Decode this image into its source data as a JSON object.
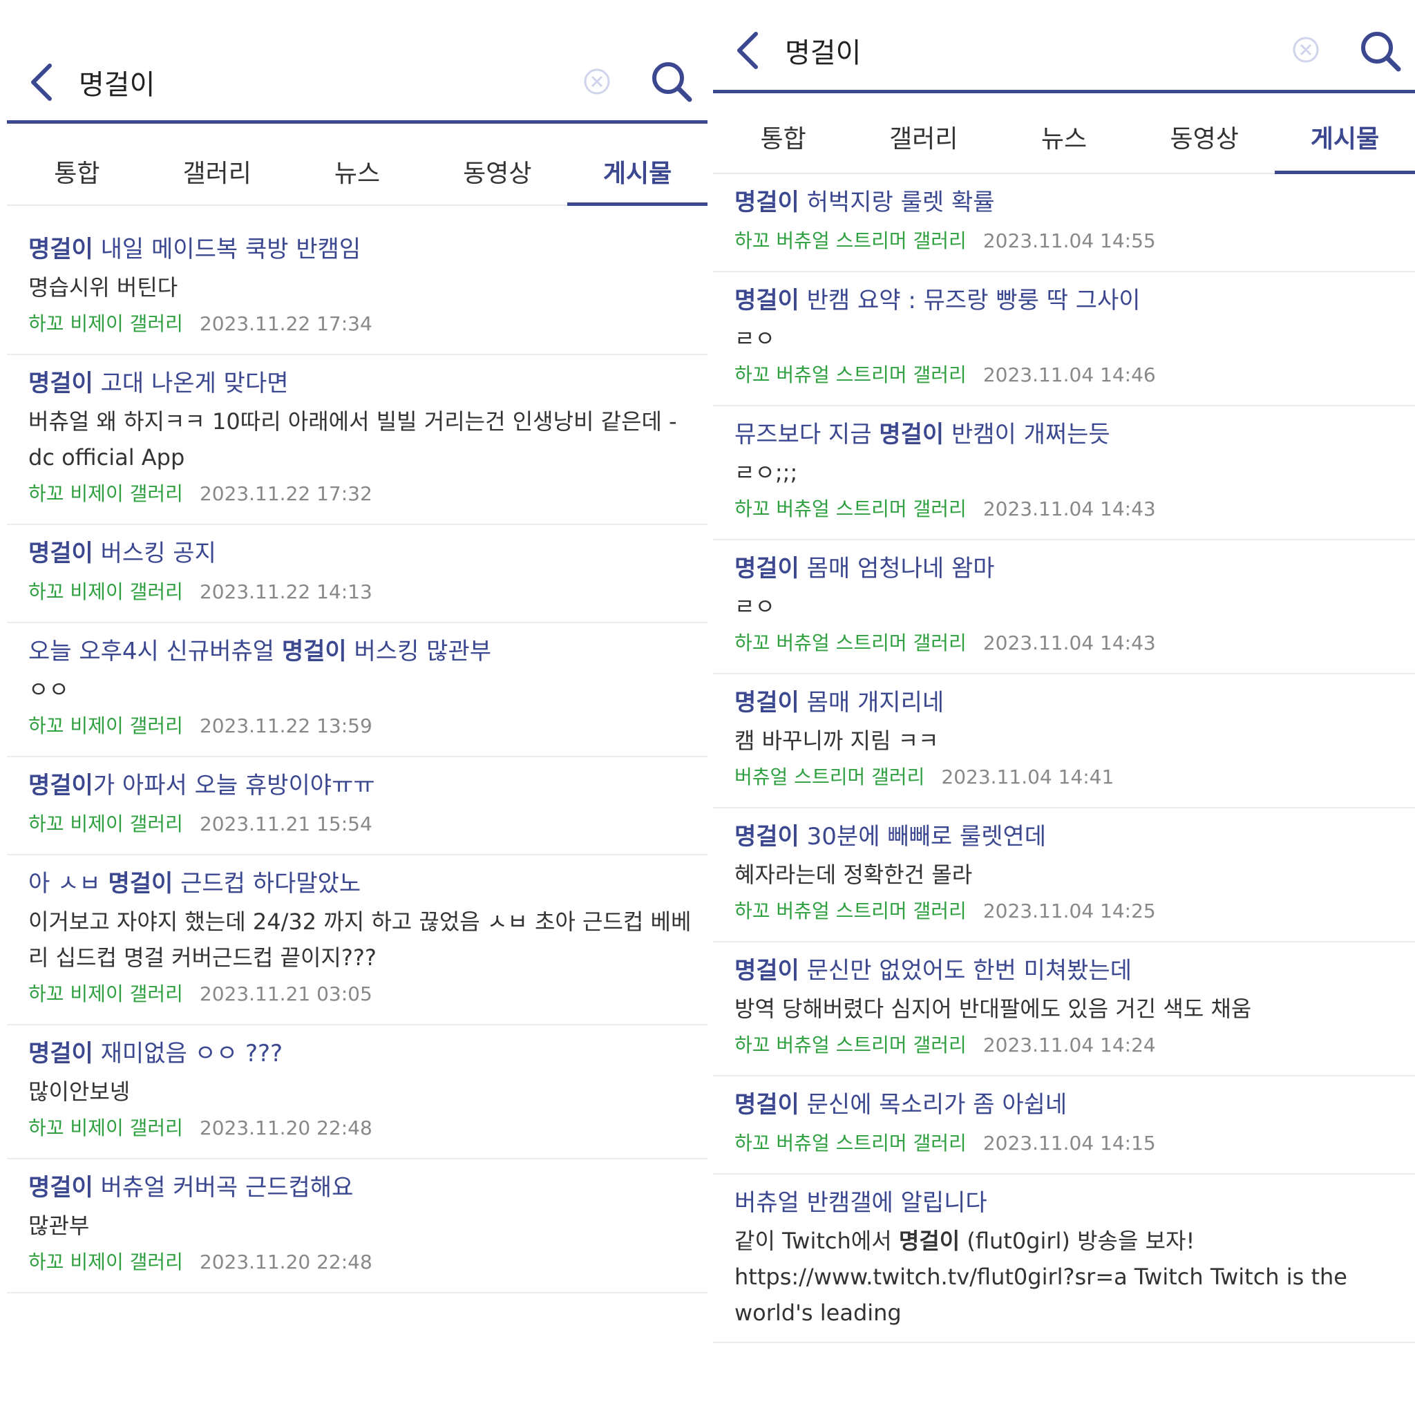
{
  "left": {
    "query": "명걸이",
    "tabs": [
      "통합",
      "갤러리",
      "뉴스",
      "동영상",
      "게시물"
    ],
    "active_tab": 4,
    "results": [
      {
        "title_pre": "",
        "title_kw": "명걸이",
        "title_post": " 내일 메이드복 쿡방 반캠임",
        "snippet": "명습시위 버틴다",
        "gallery": "하꼬 비제이 갤러리",
        "date": "2023.11.22 17:34"
      },
      {
        "title_pre": "",
        "title_kw": "명걸이",
        "title_post": " 고대 나온게 맞다면",
        "snippet": "버츄얼 왜 하지ㅋㅋ 10따리 아래에서 빌빌 거리는건 인생낭비 같은데 - dc official App",
        "gallery": "하꼬 비제이 갤러리",
        "date": "2023.11.22 17:32"
      },
      {
        "title_pre": "",
        "title_kw": "명걸이",
        "title_post": " 버스킹 공지",
        "snippet": "",
        "gallery": "하꼬 비제이 갤러리",
        "date": "2023.11.22 14:13"
      },
      {
        "title_pre": "오늘 오후4시 신규버츄얼 ",
        "title_kw": "명걸이",
        "title_post": " 버스킹 많관부",
        "snippet": "ㅇㅇ",
        "gallery": "하꼬 비제이 갤러리",
        "date": "2023.11.22 13:59"
      },
      {
        "title_pre": "",
        "title_kw": "명걸이",
        "title_post": "가 아파서 오늘 휴방이야ㅠㅠ",
        "snippet": "",
        "gallery": "하꼬 비제이 갤러리",
        "date": "2023.11.21 15:54"
      },
      {
        "title_pre": "아 ㅅㅂ ",
        "title_kw": "명걸이",
        "title_post": " 근드컵 하다말았노",
        "snippet": "이거보고 자야지 했는데 24/32 까지 하고 끊었음 ㅅㅂ 초아 근드컵 베베리 십드컵 명걸 커버근드컵 끝이지???",
        "gallery": "하꼬 비제이 갤러리",
        "date": "2023.11.21 03:05"
      },
      {
        "title_pre": "",
        "title_kw": "명걸이",
        "title_post": " 재미없음 ㅇㅇ ???",
        "snippet": "많이안보넹",
        "gallery": "하꼬 비제이 갤러리",
        "date": "2023.11.20 22:48"
      },
      {
        "title_pre": "",
        "title_kw": "명걸이",
        "title_post": " 버츄얼 커버곡 근드컵해요",
        "snippet": "많관부",
        "gallery": "하꼬 비제이 갤러리",
        "date": "2023.11.20 22:48"
      }
    ]
  },
  "right": {
    "query": "명걸이",
    "tabs": [
      "통합",
      "갤러리",
      "뉴스",
      "동영상",
      "게시물"
    ],
    "active_tab": 4,
    "results": [
      {
        "title_pre": "",
        "title_kw": "명걸이",
        "title_post": " 허벅지랑 룰렛 확률",
        "snippet": "",
        "gallery": "하꼬 버츄얼 스트리머 갤러리",
        "date": "2023.11.04 14:55"
      },
      {
        "title_pre": "",
        "title_kw": "명걸이",
        "title_post": " 반캠 요약 : 뮤즈랑 빵룽 딱 그사이",
        "snippet": "ㄹㅇ",
        "gallery": "하꼬 버츄얼 스트리머 갤러리",
        "date": "2023.11.04 14:46"
      },
      {
        "title_pre": "뮤즈보다 지금 ",
        "title_kw": "명걸이",
        "title_post": " 반캠이 개쩌는듯",
        "snippet": "ㄹㅇ;;;",
        "gallery": "하꼬 버츄얼 스트리머 갤러리",
        "date": "2023.11.04 14:43"
      },
      {
        "title_pre": "",
        "title_kw": "명걸이",
        "title_post": " 몸매 엄청나네 왐마",
        "snippet": "ㄹㅇ",
        "gallery": "하꼬 버츄얼 스트리머 갤러리",
        "date": "2023.11.04 14:43"
      },
      {
        "title_pre": "",
        "title_kw": "명걸이",
        "title_post": " 몸매 개지리네",
        "snippet": "캠 바꾸니까 지림 ㅋㅋ",
        "gallery": "버츄얼 스트리머 갤러리",
        "date": "2023.11.04 14:41"
      },
      {
        "title_pre": "",
        "title_kw": "명걸이",
        "title_post": " 30분에 빼빼로 룰렛연데",
        "snippet": "혜자라는데 정확한건 몰라",
        "gallery": "하꼬 버츄얼 스트리머 갤러리",
        "date": "2023.11.04 14:25"
      },
      {
        "title_pre": "",
        "title_kw": "명걸이",
        "title_post": " 문신만 없었어도 한번 미쳐봤는데",
        "snippet": "방역 당해버렸다 심지어 반대팔에도 있음 거긴 색도 채움",
        "gallery": "하꼬 버츄얼 스트리머 갤러리",
        "date": "2023.11.04 14:24"
      },
      {
        "title_pre": "",
        "title_kw": "명걸이",
        "title_post": " 문신에 목소리가 좀 아쉽네",
        "snippet": "",
        "gallery": "하꼬 버츄얼 스트리머 갤러리",
        "date": "2023.11.04 14:15"
      },
      {
        "title_pre": "버츄얼 반캠갤에 알립니다",
        "title_kw": "",
        "title_post": "",
        "snippet_pre": "같이 Twitch에서 ",
        "snippet_kw": "명걸이",
        "snippet_post": " (flut0girl) 방송을 보자! https://www.twitch.tv/flut0girl?sr=a Twitch Twitch is the world's leading",
        "gallery": "",
        "date": ""
      }
    ]
  },
  "colors": {
    "accent": "#3b4890",
    "gallery": "#2ea03f",
    "date": "#888888"
  },
  "icons": {
    "back": "chevron-left-icon",
    "clear": "clear-circle-icon",
    "search": "search-icon"
  }
}
